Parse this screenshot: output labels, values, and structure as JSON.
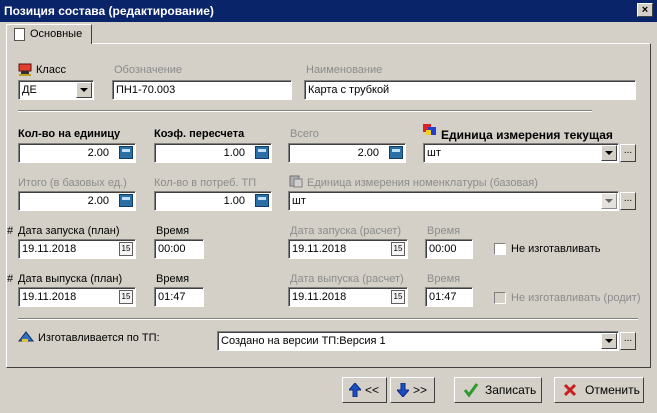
{
  "window": {
    "title": "Позиция состава (редактирование)",
    "close": "×"
  },
  "tab": {
    "label": "Основные"
  },
  "row1": {
    "class_label": "Класс",
    "class_value": "ДЕ",
    "designation_label": "Обозначение",
    "designation_value": "ПН1-70.003",
    "name_label": "Наименование",
    "name_value": "Карта с трубкой"
  },
  "row2": {
    "qty_per_unit_label": "Кол-во на единицу",
    "qty_per_unit_value": "2.00",
    "conv_factor_label": "Коэф. пересчета",
    "conv_factor_value": "1.00",
    "total_label": "Всего",
    "total_value": "2.00",
    "unit_current_label": "Единица измерения текущая",
    "unit_current_value": "шт"
  },
  "row3": {
    "total_base_label": "Итого (в базовых ед.)",
    "total_base_value": "2.00",
    "qty_tp_label": "Кол-во в потреб. ТП",
    "qty_tp_value": "1.00",
    "unit_base_label": "Единица измерения номенклатуры (базовая)",
    "unit_base_value": "шт"
  },
  "row4": {
    "hash": "#",
    "launch_plan_label": "Дата запуска (план)",
    "launch_plan_value": "19.11.2018",
    "time1_label": "Время",
    "time1_value": "00:00",
    "launch_calc_label": "Дата запуска (расчет)",
    "launch_calc_value": "19.11.2018",
    "time2_label": "Время",
    "time2_value": "00:00",
    "no_make_label": "Не изготавливать"
  },
  "row5": {
    "hash": "#",
    "release_plan_label": "Дата выпуска (план)",
    "release_plan_value": "19.11.2018",
    "time1_label": "Время",
    "time1_value": "01:47",
    "release_calc_label": "Дата выпуска (расчет)",
    "release_calc_value": "19.11.2018",
    "time2_label": "Время",
    "time2_value": "01:47",
    "no_make_parent_label": "Не изготавливать (родит)"
  },
  "row6": {
    "made_by_tp_label": "Изготавливается по ТП:",
    "made_by_tp_value": "Создано на версии ТП:Версия 1"
  },
  "buttons": {
    "prev_label": "<<",
    "next_label": ">>",
    "save_label": "Записать",
    "cancel_label": "Отменить"
  },
  "icons": {
    "cal_glyph": "15",
    "dots_glyph": "...",
    "accent": "#0a246a",
    "save_color": "#2e9b2e",
    "cancel_color": "#c81e1e"
  }
}
